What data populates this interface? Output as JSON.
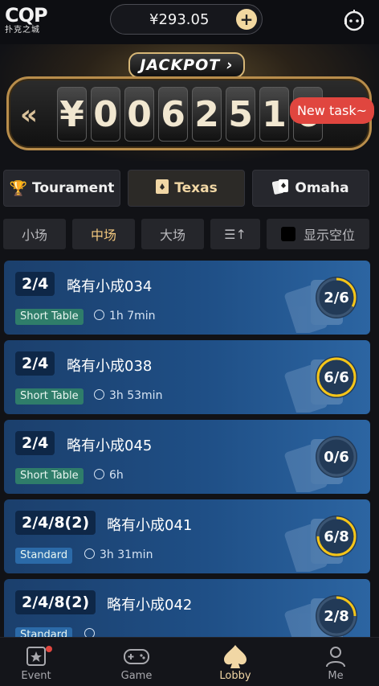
{
  "header": {
    "logo_mark": "CQP",
    "logo_sub": "扑克之城",
    "balance": "¥293.05",
    "add_symbol": "+"
  },
  "jackpot": {
    "title": "JACKPOT",
    "currency": "¥",
    "digits": [
      "0",
      "0",
      "6",
      "2",
      "5",
      "1",
      "6"
    ],
    "new_task": "New task~"
  },
  "game_tabs": [
    {
      "label": "Tourament",
      "icon": "trophy-icon"
    },
    {
      "label": "Texas",
      "icon": "card-icon"
    },
    {
      "label": "Omaha",
      "icon": "cards-icon"
    }
  ],
  "filters": {
    "small": "小场",
    "medium": "中场",
    "large": "大场",
    "sort_symbol": "☰↑",
    "show_empty": "显示空位"
  },
  "rooms": [
    {
      "blinds": "2/4",
      "name": "略有小成034",
      "type": "Short Table",
      "time": "1h 7min",
      "seats": "2/6",
      "fill": 0.33
    },
    {
      "blinds": "2/4",
      "name": "略有小成038",
      "type": "Short Table",
      "time": "3h 53min",
      "seats": "6/6",
      "fill": 1.0
    },
    {
      "blinds": "2/4",
      "name": "略有小成045",
      "type": "Short Table",
      "time": "6h",
      "seats": "0/6",
      "fill": 0.0
    },
    {
      "blinds": "2/4/8(2)",
      "name": "略有小成041",
      "type": "Standard",
      "time": "3h 31min",
      "seats": "6/8",
      "fill": 0.75
    },
    {
      "blinds": "2/4/8(2)",
      "name": "略有小成042",
      "type": "Standard",
      "time": "",
      "seats": "2/8",
      "fill": 0.25
    }
  ],
  "nav": [
    {
      "label": "Event",
      "icon": "event-icon"
    },
    {
      "label": "Game",
      "icon": "gamepad-icon"
    },
    {
      "label": "Lobby",
      "icon": "spade-icon"
    },
    {
      "label": "Me",
      "icon": "user-icon"
    }
  ],
  "colors": {
    "accent_gold": "#f1d7a5",
    "seat_ring": "#f5c518",
    "room_blue": "#1f4f86",
    "badge_red": "#e0463f"
  }
}
